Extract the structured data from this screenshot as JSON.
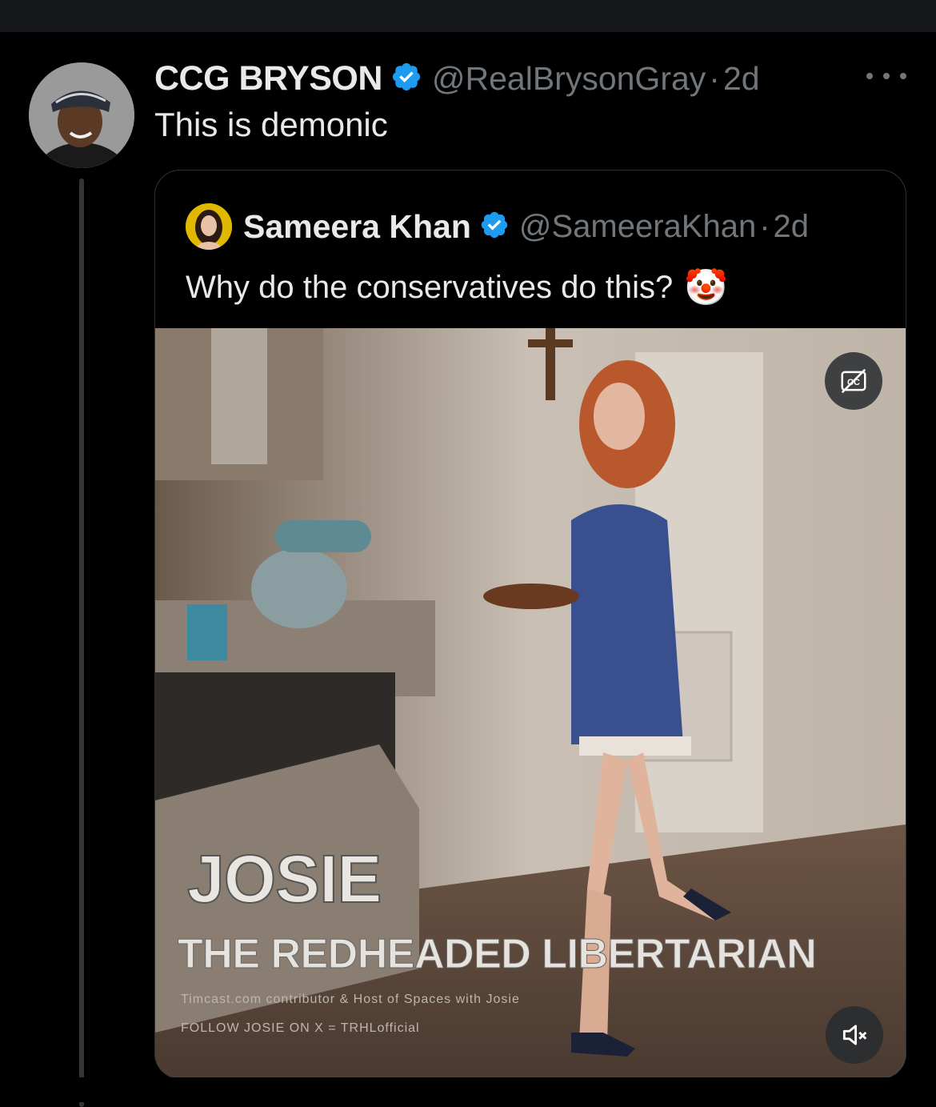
{
  "tweet": {
    "author_name": "CCG BRYSON",
    "author_handle": "@RealBrysonGray",
    "separator": "·",
    "time": "2d",
    "text": "This is demonic",
    "more_icon": "more-horizontal-icon",
    "verified_icon": "verified-badge-icon"
  },
  "quote": {
    "author_name": "Sameera Khan",
    "author_handle": "@SameeraKhan",
    "separator": "·",
    "time": "2d",
    "text": "Why do the conservatives do this?",
    "emoji": "🤡",
    "media": {
      "caption_name": "JOSIE",
      "caption_title": "THE REDHEADED LIBERTARIAN",
      "caption_line1": "Timcast.com contributor & Host of Spaces with Josie",
      "caption_line2": "FOLLOW JOSIE ON X = TRHLofficial",
      "captions_button_icon": "closed-captions-icon",
      "mute_button_icon": "volume-muted-icon"
    }
  },
  "colors": {
    "background": "#000000",
    "text_primary": "#e7e9ea",
    "text_secondary": "#71767b",
    "verified_blue": "#1d9bf0",
    "border": "#2f3336"
  }
}
